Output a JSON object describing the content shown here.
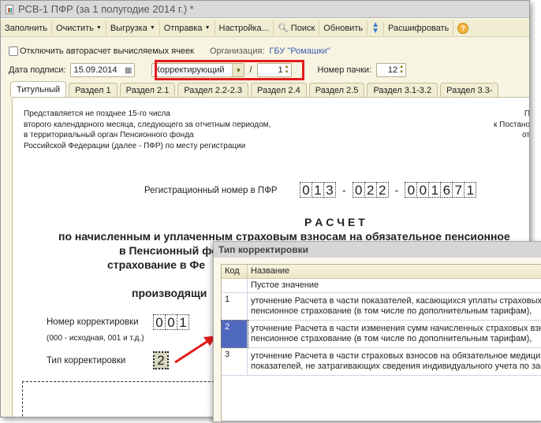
{
  "window": {
    "title": "РСВ-1 ПФР (за 1 полугодие 2014 г.) *"
  },
  "toolbar": [
    "Заполнить",
    "Очистить",
    "Выгрузка",
    "Отправка",
    "Настройка...",
    "Поиск",
    "Обновить",
    "Расшифровать"
  ],
  "form": {
    "disable_autocalc": "Отключить авторасчет вычисляемых ячеек",
    "org_label": "Организация:",
    "org_value": "ГБУ \"Ромашки\"",
    "date_label": "Дата подписи:",
    "date_value": "15.09.2014",
    "type_value": "Корректирующий",
    "slash": "/",
    "corr_number": "1",
    "pack_label": "Номер пачки:",
    "pack_value": "12"
  },
  "tabs": [
    "Титульный",
    "Раздел 1",
    "Раздел 2.1",
    "Раздел 2.2-2.3",
    "Раздел 2.4",
    "Раздел 2.5",
    "Раздел 3.1-3.2",
    "Раздел 3.3-"
  ],
  "doc": {
    "notice": [
      "Представляется не позднее 15-го числа",
      "второго календарного месяца, следующего за отчетным периодом,",
      "в территориальный орган Пенсионного фонда",
      "Российской Федерации (далее - ПФР) по месту регистрации"
    ],
    "right_notice": [
      "П",
      "к Постано",
      "от"
    ],
    "reg_label": "Регистрационный номер в ПФР",
    "reg_groups": [
      [
        "0",
        "1",
        "3"
      ],
      [
        "0",
        "2",
        "2"
      ],
      [
        "0",
        "0",
        "1",
        "6",
        "7",
        "1"
      ]
    ],
    "reg_sep": "-",
    "title": "Р А С Ч Е Т",
    "subtitle": [
      "по начисленным и уплаченным страховым взносам на обязательное пенсионное",
      "в Пенсионный фо",
      "страхование в Фе",
      "производящи"
    ],
    "corr_num_label": "Номер корректировки",
    "corr_num_cells": [
      "0",
      "0",
      "1"
    ],
    "corr_num_hint": "(000 - исходная, 001 и т.д.)",
    "corr_type_label": "Тип корректировки",
    "corr_type_value": "2"
  },
  "dialog": {
    "title": "Тип корректировки",
    "col_code": "Код",
    "col_name": "Название",
    "rows": [
      {
        "code": "",
        "lines": [
          "Пустое значение"
        ]
      },
      {
        "code": "1",
        "lines": [
          "уточнение Расчета в части показателей, касающихся  уплаты страховых взносов на обязательное",
          "пенсионное страхование (в том числе по дополнительным тарифам),"
        ]
      },
      {
        "code": "2",
        "lines": [
          "уточнение Расчета в части изменения сумм начисленных страховых взносов на обязательное",
          "пенсионное страхование (в том числе по дополнительным тарифам),"
        ]
      },
      {
        "code": "3",
        "lines": [
          "уточнение Расчета в части страховых взносов на обязательное медицинское страхование,",
          "показателей, не затрагивающих сведения индивидуального учета по застрахованным лицам"
        ]
      }
    ]
  },
  "colors": {
    "highlight": "#e21b1b",
    "selected_row": "#4f68c0",
    "link": "#3c5fb0"
  }
}
